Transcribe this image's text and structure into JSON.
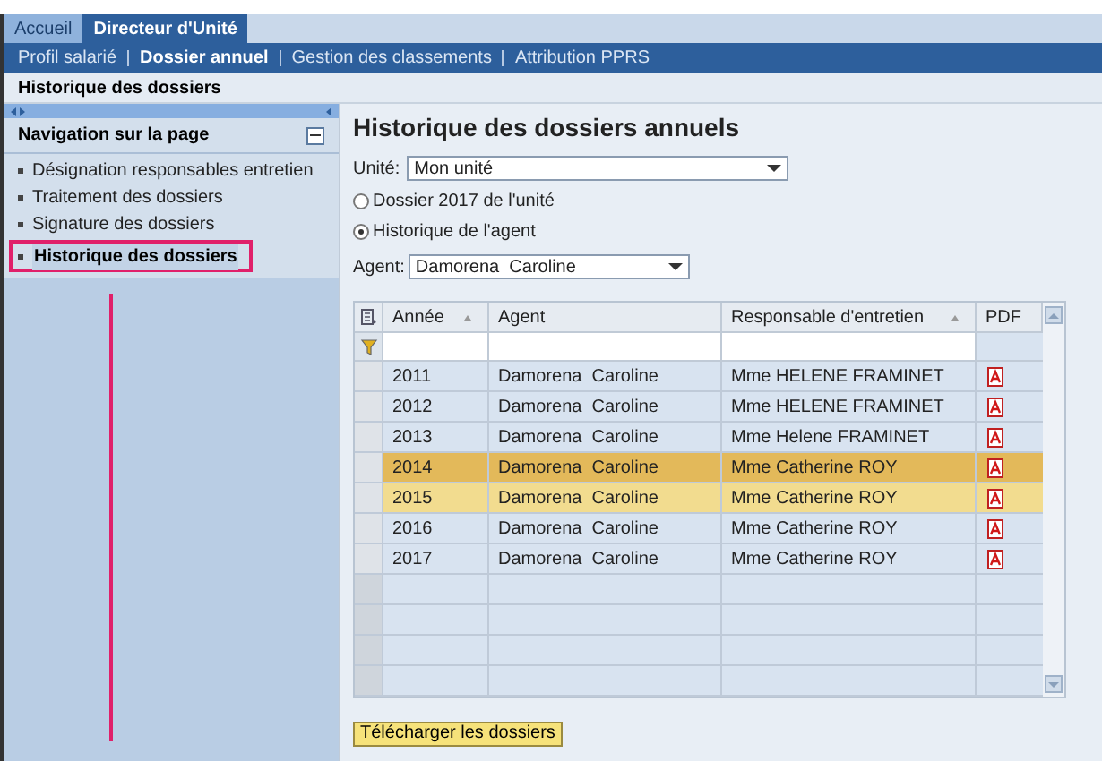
{
  "tabs": [
    {
      "label": "Accueil",
      "selected": false
    },
    {
      "label": "Directeur d'Unité",
      "selected": true
    }
  ],
  "subnav": [
    {
      "label": "Profil salarié",
      "selected": false
    },
    {
      "label": "Dossier annuel",
      "selected": true
    },
    {
      "label": "Gestion des classements",
      "selected": false
    },
    {
      "label": "Attribution PPRS",
      "selected": false
    }
  ],
  "breadcrumb": "Historique des dossiers",
  "sidebar": {
    "title": "Navigation sur la page",
    "items": [
      {
        "label": "Désignation responsables entretien",
        "selected": false
      },
      {
        "label": "Traitement des dossiers",
        "selected": false
      },
      {
        "label": "Signature des dossiers",
        "selected": false
      },
      {
        "label": "Historique des dossiers",
        "selected": true
      }
    ]
  },
  "page_title": "Historique des dossiers annuels",
  "unit": {
    "label": "Unité:",
    "value": "Mon unité"
  },
  "radios": [
    {
      "label": "Dossier 2017 de l'unité",
      "selected": false
    },
    {
      "label": "Historique de l'agent",
      "selected": true
    }
  ],
  "agent": {
    "label": "Agent:",
    "value": "Damorena  Caroline"
  },
  "table": {
    "columns": [
      {
        "label": "Année",
        "sortable": true
      },
      {
        "label": "Agent",
        "sortable": false
      },
      {
        "label": "Responsable d'entretien",
        "sortable": true
      },
      {
        "label": "PDF",
        "sortable": false
      }
    ],
    "rows": [
      {
        "year": "2011",
        "agent": "Damorena  Caroline",
        "manager": "Mme HELENE FRAMINET",
        "selected": false,
        "lead": false
      },
      {
        "year": "2012",
        "agent": "Damorena  Caroline",
        "manager": "Mme HELENE FRAMINET",
        "selected": false,
        "lead": false
      },
      {
        "year": "2013",
        "agent": "Damorena  Caroline",
        "manager": "Mme Helene FRAMINET",
        "selected": false,
        "lead": false
      },
      {
        "year": "2014",
        "agent": "Damorena  Caroline",
        "manager": "Mme Catherine ROY",
        "selected": true,
        "lead": true
      },
      {
        "year": "2015",
        "agent": "Damorena  Caroline",
        "manager": "Mme Catherine ROY",
        "selected": true,
        "lead": false
      },
      {
        "year": "2016",
        "agent": "Damorena  Caroline",
        "manager": "Mme Catherine ROY",
        "selected": false,
        "lead": false
      },
      {
        "year": "2017",
        "agent": "Damorena  Caroline",
        "manager": "Mme Catherine ROY",
        "selected": false,
        "lead": false
      }
    ]
  },
  "download_button": "Télécharger les dossiers"
}
